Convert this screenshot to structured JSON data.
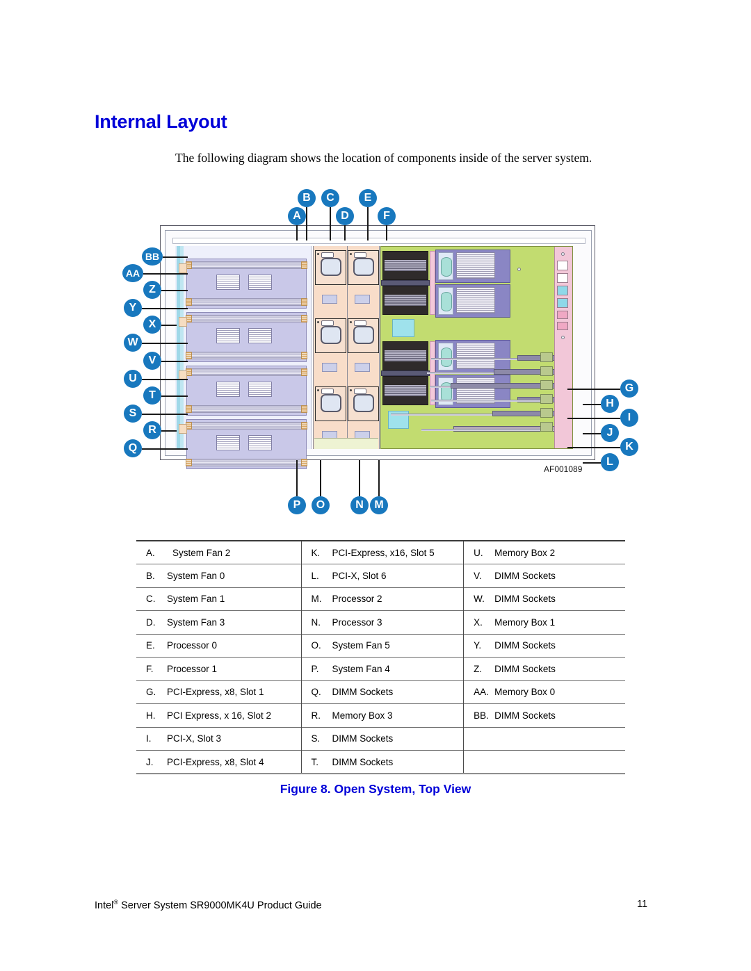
{
  "page": {
    "title": "Internal Layout",
    "intro": "The following diagram shows the location of components inside of the server system.",
    "caption": "Figure 8. Open System, Top View",
    "drawing_id": "AF001089"
  },
  "footer": {
    "text_before_sup": "Intel",
    "sup": "®",
    "text_after_sup": " Server System SR9000MK4U Product Guide",
    "page_number": "11"
  },
  "colors": {
    "heading_blue": "#0000d8",
    "callout_blue": "#1878be",
    "motherboard_green": "#c2dc70",
    "memory_box_purple": "#c9c8e8",
    "fan_bay_peach": "#f8ddc9",
    "io_panel_pink": "#f2c7d8"
  },
  "callouts": {
    "top": [
      {
        "label": "A"
      },
      {
        "label": "B"
      },
      {
        "label": "C"
      },
      {
        "label": "D"
      },
      {
        "label": "E"
      },
      {
        "label": "F"
      }
    ],
    "right": [
      {
        "label": "G"
      },
      {
        "label": "H"
      },
      {
        "label": "I"
      },
      {
        "label": "J"
      },
      {
        "label": "K"
      },
      {
        "label": "L"
      }
    ],
    "bottom": [
      {
        "label": "M"
      },
      {
        "label": "N"
      },
      {
        "label": "O"
      },
      {
        "label": "P"
      }
    ],
    "left": [
      {
        "label": "Q"
      },
      {
        "label": "R"
      },
      {
        "label": "S"
      },
      {
        "label": "T"
      },
      {
        "label": "U"
      },
      {
        "label": "V"
      },
      {
        "label": "W"
      },
      {
        "label": "X"
      },
      {
        "label": "Y"
      },
      {
        "label": "Z"
      },
      {
        "label": "AA"
      },
      {
        "label": "BB"
      }
    ]
  },
  "legend": {
    "rows": [
      {
        "c1": {
          "letter": "A.",
          "text": "System Fan 2",
          "extra_indent": true
        },
        "c2": {
          "letter": "K.",
          "text": "PCI-Express, x16, Slot 5"
        },
        "c3": {
          "letter": "U.",
          "text": "Memory Box 2"
        }
      },
      {
        "c1": {
          "letter": "B.",
          "text": "System Fan 0"
        },
        "c2": {
          "letter": "L.",
          "text": "PCI-X, Slot 6"
        },
        "c3": {
          "letter": "V.",
          "text": "DIMM Sockets"
        }
      },
      {
        "c1": {
          "letter": "C.",
          "text": "System Fan 1"
        },
        "c2": {
          "letter": "M.",
          "text": "Processor 2"
        },
        "c3": {
          "letter": "W.",
          "text": "DIMM Sockets"
        }
      },
      {
        "c1": {
          "letter": "D.",
          "text": "System Fan 3"
        },
        "c2": {
          "letter": "N.",
          "text": "Processor 3"
        },
        "c3": {
          "letter": "X.",
          "text": "Memory Box 1"
        }
      },
      {
        "c1": {
          "letter": "E.",
          "text": "Processor 0"
        },
        "c2": {
          "letter": "O.",
          "text": "System Fan 5"
        },
        "c3": {
          "letter": "Y.",
          "text": "DIMM Sockets"
        }
      },
      {
        "c1": {
          "letter": "F.",
          "text": "Processor 1"
        },
        "c2": {
          "letter": "P.",
          "text": "System Fan 4"
        },
        "c3": {
          "letter": "Z.",
          "text": "DIMM Sockets"
        }
      },
      {
        "c1": {
          "letter": "G.",
          "text": "PCI-Express, x8, Slot 1"
        },
        "c2": {
          "letter": "Q.",
          "text": "DIMM Sockets"
        },
        "c3": {
          "letter": "AA.",
          "text": "Memory Box 0"
        }
      },
      {
        "c1": {
          "letter": "H.",
          "text": "PCI Express, x 16, Slot 2"
        },
        "c2": {
          "letter": "R.",
          "text": "Memory Box 3"
        },
        "c3": {
          "letter": "BB.",
          "text": "DIMM Sockets"
        }
      },
      {
        "c1": {
          "letter": "I.",
          "text": "PCI-X, Slot 3"
        },
        "c2": {
          "letter": "S.",
          "text": "DIMM Sockets"
        },
        "c3": {
          "letter": "",
          "text": ""
        }
      },
      {
        "c1": {
          "letter": "J.",
          "text": "PCI-Express, x8, Slot 4"
        },
        "c2": {
          "letter": "T.",
          "text": "DIMM Sockets"
        },
        "c3": {
          "letter": "",
          "text": ""
        }
      }
    ]
  }
}
